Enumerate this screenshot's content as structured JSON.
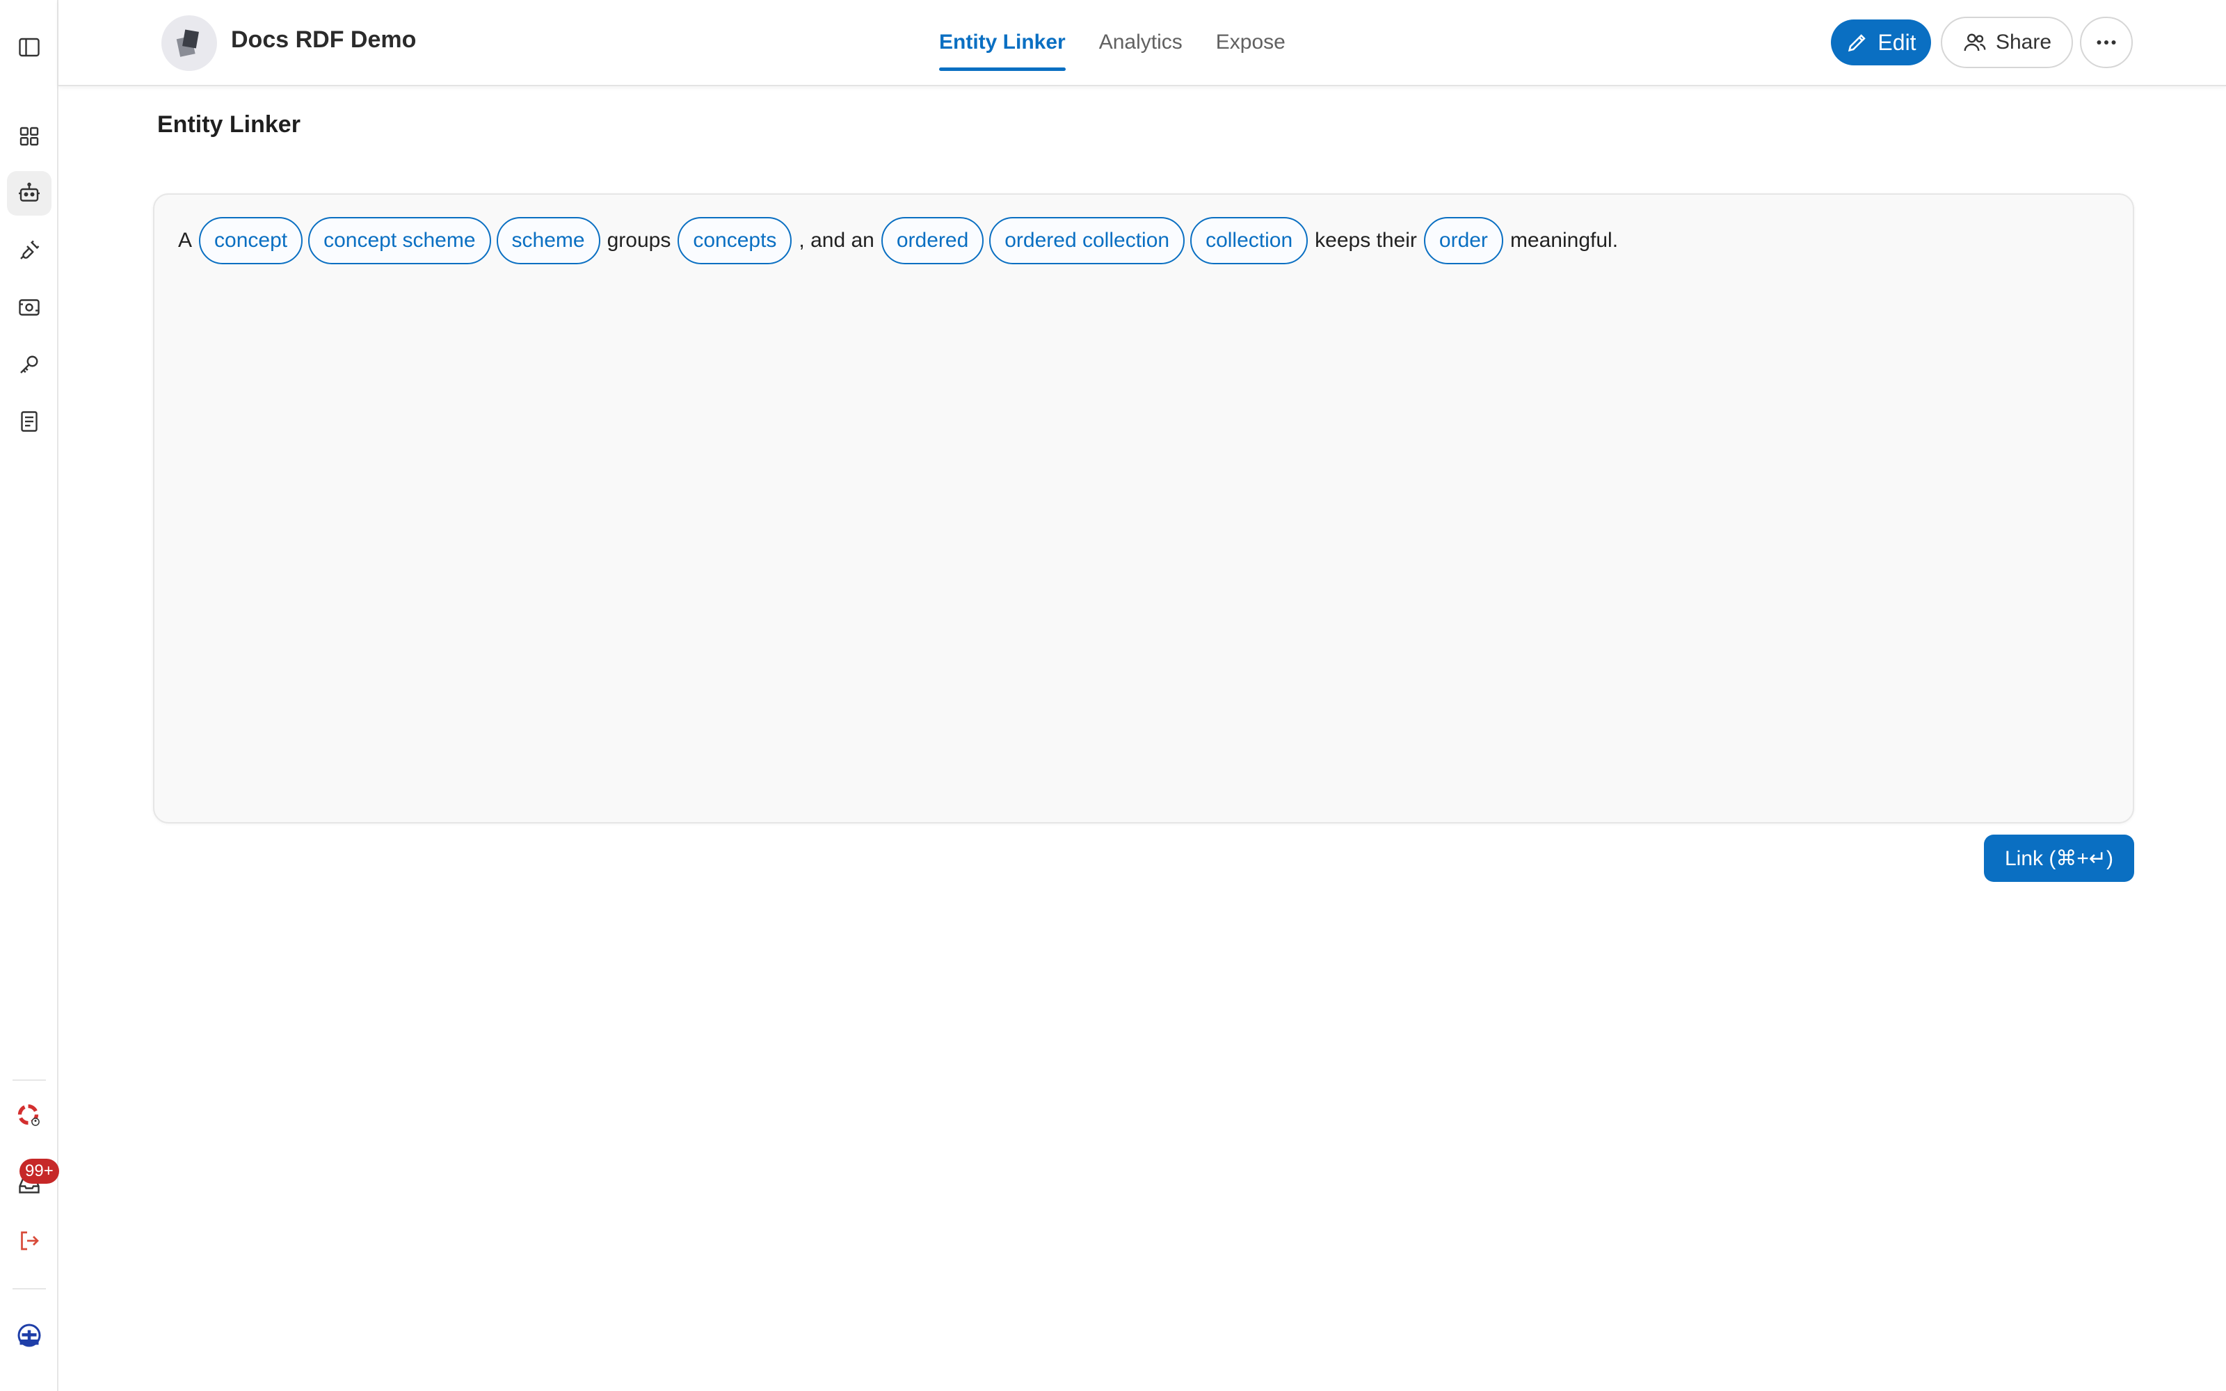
{
  "header": {
    "app_title": "Docs RDF Demo",
    "tabs": [
      {
        "label": "Entity Linker",
        "active": true
      },
      {
        "label": "Analytics",
        "active": false
      },
      {
        "label": "Expose",
        "active": false
      }
    ],
    "edit_label": "Edit",
    "share_label": "Share"
  },
  "sidebar": {
    "items": [
      {
        "icon": "panel-toggle-icon"
      },
      {
        "icon": "dashboard-grid-icon"
      },
      {
        "icon": "robot-icon",
        "active": true
      },
      {
        "icon": "plug-icon"
      },
      {
        "icon": "scan-icon"
      },
      {
        "icon": "key-icon"
      },
      {
        "icon": "document-icon"
      }
    ],
    "bottom": {
      "help_icon": "lifebuoy-icon",
      "inbox_badge": "99+",
      "logout_icon": "logout-icon",
      "avatar_icon": "user-avatar-icon"
    }
  },
  "main": {
    "page_title": "Entity Linker",
    "segments": [
      {
        "text": "A",
        "entity": false
      },
      {
        "text": "concept",
        "entity": true
      },
      {
        "text": "concept scheme",
        "entity": true
      },
      {
        "text": "scheme",
        "entity": true
      },
      {
        "text": "groups",
        "entity": false
      },
      {
        "text": "concepts",
        "entity": true
      },
      {
        "text": ", and an",
        "entity": false
      },
      {
        "text": "ordered",
        "entity": true
      },
      {
        "text": "ordered collection",
        "entity": true
      },
      {
        "text": "collection",
        "entity": true
      },
      {
        "text": "keeps their",
        "entity": false
      },
      {
        "text": "order",
        "entity": true
      },
      {
        "text": "meaningful.",
        "entity": false
      }
    ],
    "link_button": "Link (⌘+↵)"
  },
  "colors": {
    "accent": "#0a6fc2",
    "badge": "#c62828",
    "logout": "#d84b3a"
  }
}
